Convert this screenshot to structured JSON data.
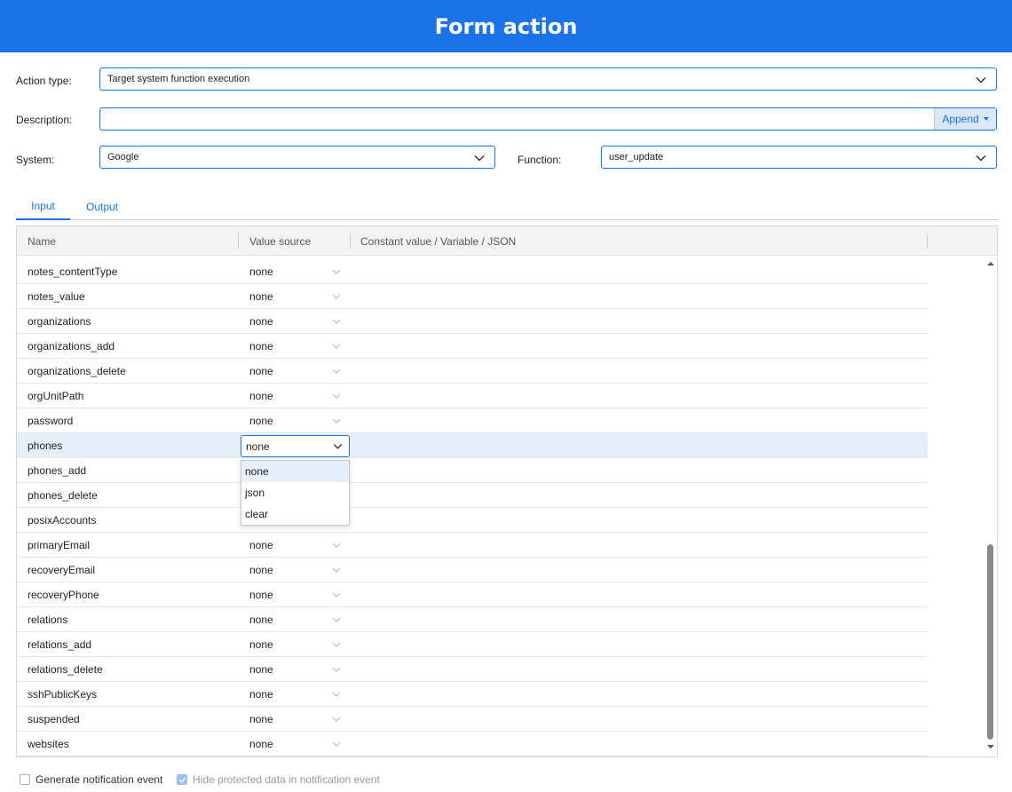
{
  "header": {
    "title": "Form action"
  },
  "form": {
    "action_type_label": "Action type:",
    "action_type_value": "Target system function execution",
    "description_label": "Description:",
    "description_value": "",
    "append_label": "Append",
    "system_label": "System:",
    "system_value": "Google",
    "function_label": "Function:",
    "function_value": "user_update"
  },
  "tabs": [
    {
      "label": "Input",
      "active": true
    },
    {
      "label": "Output",
      "active": false
    }
  ],
  "grid": {
    "columns": [
      "Name",
      "Value source",
      "Constant value / Variable / JSON"
    ],
    "rows": [
      {
        "name": "notes_contentType",
        "value_source": "none"
      },
      {
        "name": "notes_value",
        "value_source": "none"
      },
      {
        "name": "organizations",
        "value_source": "none"
      },
      {
        "name": "organizations_add",
        "value_source": "none"
      },
      {
        "name": "organizations_delete",
        "value_source": "none"
      },
      {
        "name": "orgUnitPath",
        "value_source": "none"
      },
      {
        "name": "password",
        "value_source": "none"
      },
      {
        "name": "phones",
        "value_source": "none",
        "selected": true
      },
      {
        "name": "phones_add",
        "value_source": ""
      },
      {
        "name": "phones_delete",
        "value_source": ""
      },
      {
        "name": "posixAccounts",
        "value_source": ""
      },
      {
        "name": "primaryEmail",
        "value_source": "none"
      },
      {
        "name": "recoveryEmail",
        "value_source": "none"
      },
      {
        "name": "recoveryPhone",
        "value_source": "none"
      },
      {
        "name": "relations",
        "value_source": "none"
      },
      {
        "name": "relations_add",
        "value_source": "none"
      },
      {
        "name": "relations_delete",
        "value_source": "none"
      },
      {
        "name": "sshPublicKeys",
        "value_source": "none"
      },
      {
        "name": "suspended",
        "value_source": "none"
      },
      {
        "name": "websites",
        "value_source": "none"
      }
    ],
    "dropdown_options": [
      "none",
      "json",
      "clear"
    ]
  },
  "footer": {
    "generate_notification_label": "Generate notification event",
    "generate_notification_checked": false,
    "hide_protected_label": "Hide protected data in notification event",
    "hide_protected_checked": true
  },
  "colors": {
    "accent": "#1a73e8",
    "selected_row": "#e6eef9"
  }
}
